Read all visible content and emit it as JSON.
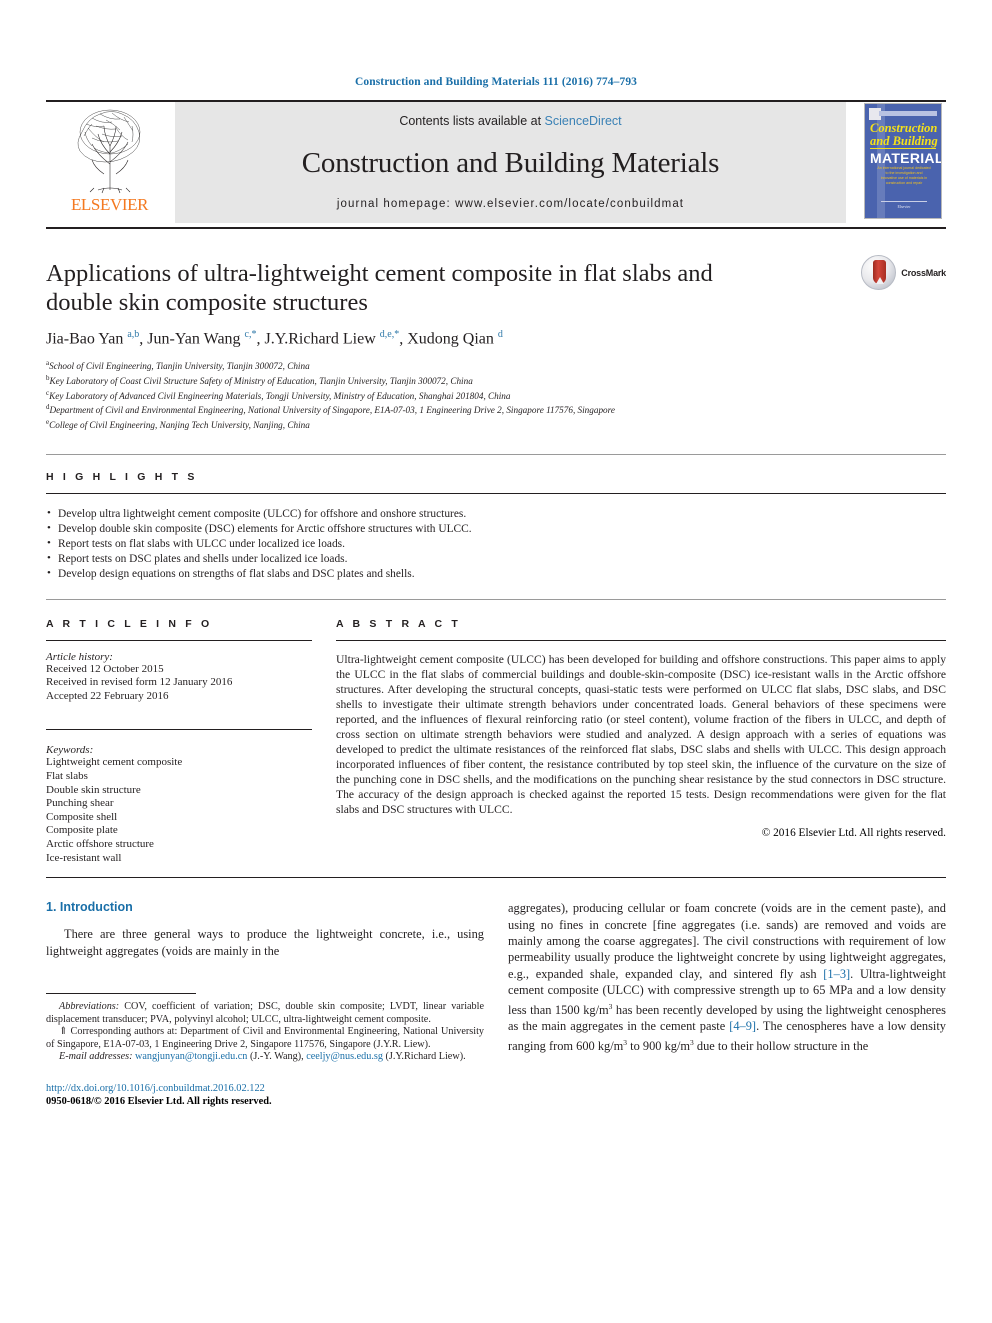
{
  "running_head": "Construction and Building Materials 111 (2016) 774–793",
  "masthead": {
    "contents_prefix": "Contents lists available at",
    "contents_link": "ScienceDirect",
    "journal_title": "Construction and Building Materials",
    "homepage": "journal homepage: www.elsevier.com/locate/conbuildmat",
    "publisher_name": "ELSEVIER",
    "cover": {
      "line1": "Construction",
      "line2": "and Building",
      "line3": "MATERIALS",
      "blurb": "An international journal dedicated to the investigation and innovative use of materials in construction and repair",
      "footer": "Elsevier"
    }
  },
  "article": {
    "title": "Applications of ultra-lightweight cement composite in flat slabs and double skin composite structures",
    "authors_html": "Jia-Bao Yan <sup>a,b</sup>, Jun-Yan Wang <sup>c,</sup><sup class=\"star\">*</sup>, J.Y.Richard Liew <sup>d,e,</sup><sup class=\"star\">*</sup>, Xudong Qian <sup>d</sup>",
    "affiliations": [
      {
        "mark": "a",
        "text": "School of Civil Engineering, Tianjin University, Tianjin 300072, China"
      },
      {
        "mark": "b",
        "text": "Key Laboratory of Coast Civil Structure Safety of Ministry of Education, Tianjin University, Tianjin 300072, China"
      },
      {
        "mark": "c",
        "text": "Key Laboratory of Advanced Civil Engineering Materials, Tongji University, Ministry of Education, Shanghai 201804, China"
      },
      {
        "mark": "d",
        "text": "Department of Civil and Environmental Engineering, National University of Singapore, E1A-07-03, 1 Engineering Drive 2, Singapore 117576, Singapore"
      },
      {
        "mark": "e",
        "text": "College of Civil Engineering, Nanjing Tech University, Nanjing, China"
      }
    ],
    "crossmark_label": "CrossMark"
  },
  "highlights": {
    "heading": "H I G H L I G H T S",
    "items": [
      "Develop ultra lightweight cement composite (ULCC) for offshore and onshore structures.",
      "Develop double skin composite (DSC) elements for Arctic offshore structures with ULCC.",
      "Report tests on flat slabs with ULCC under localized ice loads.",
      "Report tests on DSC plates and shells under localized ice loads.",
      "Develop design equations on strengths of flat slabs and DSC plates and shells."
    ]
  },
  "article_info": {
    "heading": "A R T I C L E    I N F O",
    "history_label": "Article history:",
    "history": [
      "Received 12 October 2015",
      "Received in revised form 12 January 2016",
      "Accepted 22 February 2016"
    ],
    "keywords_label": "Keywords:",
    "keywords": [
      "Lightweight cement composite",
      "Flat slabs",
      "Double skin structure",
      "Punching shear",
      "Composite shell",
      "Composite plate",
      "Arctic offshore structure",
      "Ice-resistant wall"
    ]
  },
  "abstract": {
    "heading": "A B S T R A C T",
    "text": "Ultra-lightweight cement composite (ULCC) has been developed for building and offshore constructions. This paper aims to apply the ULCC in the flat slabs of commercial buildings and double-skin-composite (DSC) ice-resistant walls in the Arctic offshore structures. After developing the structural concepts, quasi-static tests were performed on ULCC flat slabs, DSC slabs, and DSC shells to investigate their ultimate strength behaviors under concentrated loads. General behaviors of these specimens were reported, and the influences of flexural reinforcing ratio (or steel content), volume fraction of the fibers in ULCC, and depth of cross section on ultimate strength behaviors were studied and analyzed. A design approach with a series of equations was developed to predict the ultimate resistances of the reinforced flat slabs, DSC slabs and shells with ULCC. This design approach incorporated influences of fiber content, the resistance contributed by top steel skin, the influence of the curvature on the size of the punching cone in DSC shells, and the modifications on the punching shear resistance by the stud connectors in DSC structure. The accuracy of the design approach is checked against the reported 15 tests. Design recommendations were given for the flat slabs and DSC structures with ULCC.",
    "copyright": "© 2016 Elsevier Ltd. All rights reserved."
  },
  "body": {
    "section_title": "1. Introduction",
    "left_para": "There are three general ways to produce the lightweight concrete, i.e., using lightweight aggregates (voids are mainly in the",
    "right_para_1": "aggregates), producing cellular or foam concrete (voids are in the cement paste), and using no fines in concrete [fine aggregates (i.e. sands) are removed and voids are mainly among the coarse aggregates]. The civil constructions with requirement of low permeability usually produce the lightweight concrete by using lightweight aggregates, e.g., expanded shale, expanded clay, and sintered fly ash ",
    "ref_1": "[1–3]",
    "right_para_2": ". Ultra-lightweight cement composite (ULCC) with compressive strength up to 65 MPa and a low density less than 1500 kg/m",
    "right_para_2b": " has been recently developed by using the lightweight cenospheres as the main aggregates in the cement paste ",
    "ref_2": "[4–9]",
    "right_para_3": ". The cenospheres have a low density ranging from 600 kg/m",
    "right_para_3b": " to 900 kg/m",
    "right_para_3c": " due to their hollow structure in the",
    "superscript_3": "3"
  },
  "footnotes": {
    "abbrev_label": "Abbreviations:",
    "abbrev_text": " COV, coefficient of variation; DSC, double skin composite; LVDT, linear variable displacement transducer; PVA, polyvinyl alcohol; ULCC, ultra-lightweight cement composite.",
    "corresponding_marker": "⇑",
    "corresponding_text": " Corresponding authors at: Department of Civil and Environmental Engineering, National University of Singapore, E1A-07-03, 1 Engineering Drive 2, Singapore 117576, Singapore (J.Y.R. Liew).",
    "email_label": "E-mail addresses:",
    "email_1": "wangjunyan@tongji.edu.cn",
    "email_1_owner": " (J.-Y. Wang), ",
    "email_2": "ceeljy@nus.edu.sg",
    "email_2_owner": " (J.Y.Richard Liew)."
  },
  "footer": {
    "doi": "http://dx.doi.org/10.1016/j.conbuildmat.2016.02.122",
    "issn": "0950-0618/© 2016 Elsevier Ltd. All rights reserved."
  },
  "colors": {
    "link": "#1a6fa8",
    "elsevier_orange": "#f47920",
    "band_gray": "#e6e6e6",
    "cover_blue": "#4a63ae"
  }
}
